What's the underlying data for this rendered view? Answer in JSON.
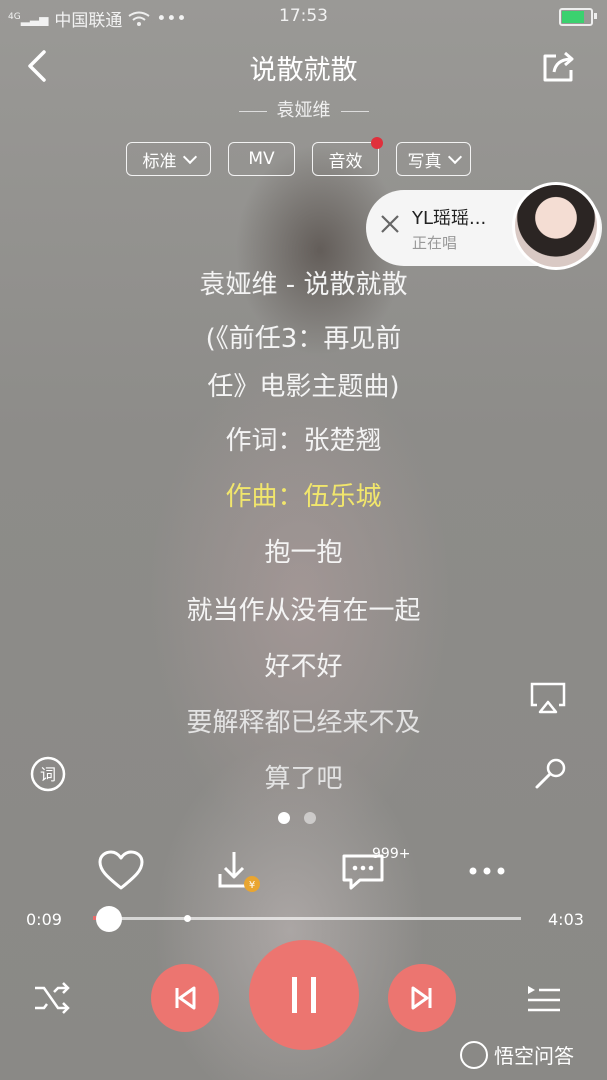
{
  "status_bar": {
    "carrier": "中国联通",
    "network": "4G",
    "time": "17:53"
  },
  "header": {
    "title": "说散就散",
    "artist": "袁娅维"
  },
  "chips": {
    "quality": "标准",
    "mv": "MV",
    "effect": "音效",
    "photo": "写真"
  },
  "singer_card": {
    "name": "YL瑶瑶...",
    "status": "正在唱"
  },
  "lyrics": [
    "袁娅维 - 说散就散",
    "(《前任3：再见前",
    "任》电影主题曲)",
    "作词：张楚翘",
    "作曲：伍乐城",
    "抱一抱",
    "就当作从没有在一起",
    "好不好",
    "要解释都已经来不及",
    "算了吧"
  ],
  "comment_count": "999+",
  "progress": {
    "current": "0:09",
    "total": "4:03",
    "played_fraction": 0.037
  },
  "watermark": "悟空问答",
  "colors": {
    "accent": "#ec7570",
    "highlight_lyric": "#f1e66c",
    "battery": "#3bd16f"
  }
}
